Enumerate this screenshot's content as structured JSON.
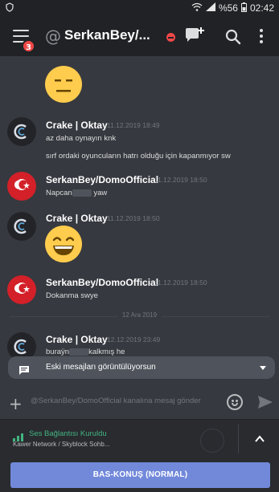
{
  "status_bar": {
    "battery": "%56",
    "time": "02:42"
  },
  "header": {
    "notification_count": "3",
    "at_symbol": "@",
    "channel_title": "SerkanBey/..."
  },
  "messages": [
    {
      "author": "Crake | Oktay",
      "timestamp": "11.12.2019 18:49",
      "lines": [
        "az daha oynayın knk",
        "sırf ordaki oyuncuların hatrı olduğu için kapanmıyor sw"
      ]
    },
    {
      "author": "SerkanBey/DomoOfficial",
      "timestamp": "11.12.2019 18:50",
      "text_before": "Napcan",
      "text_after": " yaw"
    },
    {
      "author": "Crake | Oktay",
      "timestamp": "11.12.2019 18:50"
    },
    {
      "author": "SerkanBey/DomoOfficial",
      "timestamp": "11.12.2019 18:50",
      "text": "Dokanma swye"
    },
    {
      "author": "Crake | Oktay",
      "timestamp": "12.12.2019 23:49",
      "text_before": "buraÿn",
      "text_after": "kalkmış he"
    }
  ],
  "date_divider": "12 Ara 2019",
  "old_messages_banner": "Eski mesajları görüntülüyorsun",
  "composer": {
    "placeholder": "@SerkanBey/DomoOfficial kanalına mesaj gönder"
  },
  "voice": {
    "status": "Ses Bağlantısı Kuruldu",
    "channel": "Kawer Network / Skyblock Sohb..."
  },
  "ptt_label": "BAS-KONUŞ (NORMAL)",
  "colors": {
    "background": "#36393f",
    "header": "#202225",
    "accent": "#7289da",
    "online_green": "#43b581",
    "danger_red": "#f04747"
  }
}
